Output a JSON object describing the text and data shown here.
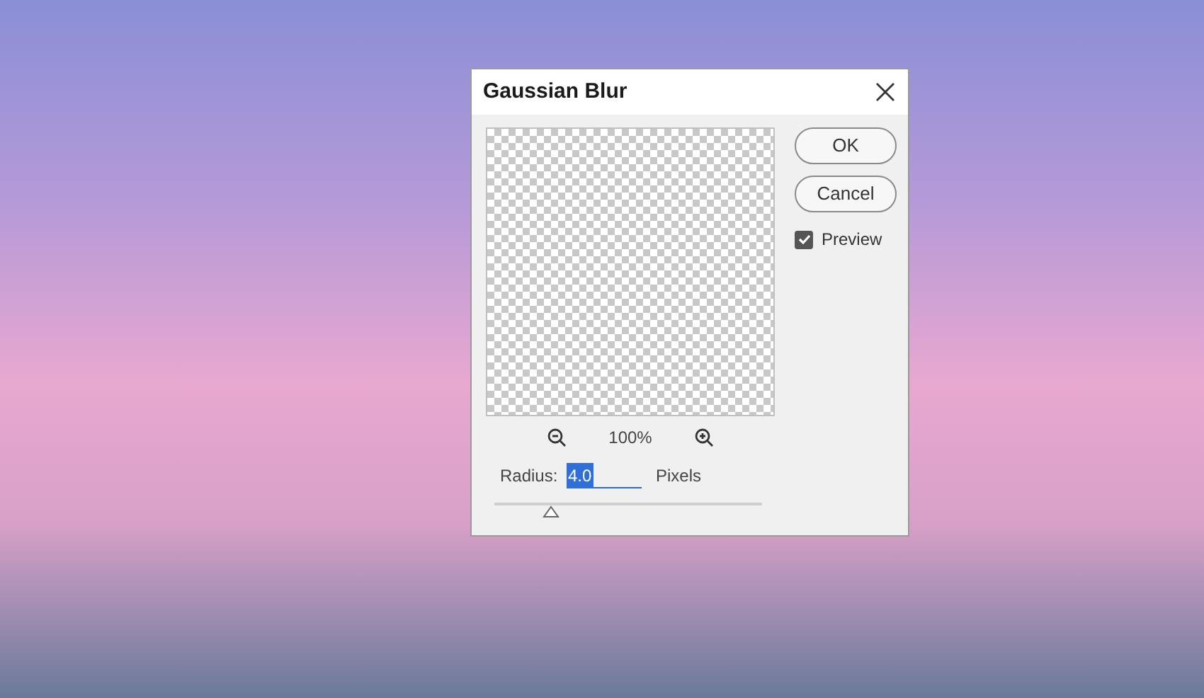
{
  "dialog": {
    "title": "Gaussian Blur",
    "zoom": {
      "level_text": "100%"
    },
    "radius": {
      "label": "Radius:",
      "value": "4.0",
      "unit": "Pixels",
      "level": 0.21
    },
    "buttons": [
      {
        "label": "OK"
      },
      {
        "label": "Cancel"
      }
    ],
    "preview": {
      "label": "Preview",
      "checked": true
    }
  }
}
